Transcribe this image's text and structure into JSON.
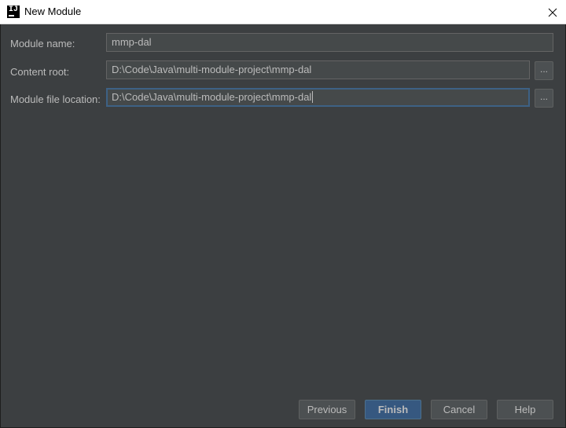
{
  "window": {
    "title": "New Module",
    "app_icon_text": "IJ"
  },
  "form": {
    "module_name": {
      "label": "Module name:",
      "value": "mmp-dal"
    },
    "content_root": {
      "label": "Content root:",
      "value": "D:\\Code\\Java\\multi-module-project\\mmp-dal",
      "browse_label": "..."
    },
    "module_file_location": {
      "label": "Module file location:",
      "value": "D:\\Code\\Java\\multi-module-project\\mmp-dal",
      "browse_label": "..."
    }
  },
  "buttons": {
    "previous": "Previous",
    "finish": "Finish",
    "cancel": "Cancel",
    "help": "Help"
  },
  "colors": {
    "background": "#3c3f41",
    "primary_button": "#365880",
    "focus_border": "#3d6185"
  }
}
